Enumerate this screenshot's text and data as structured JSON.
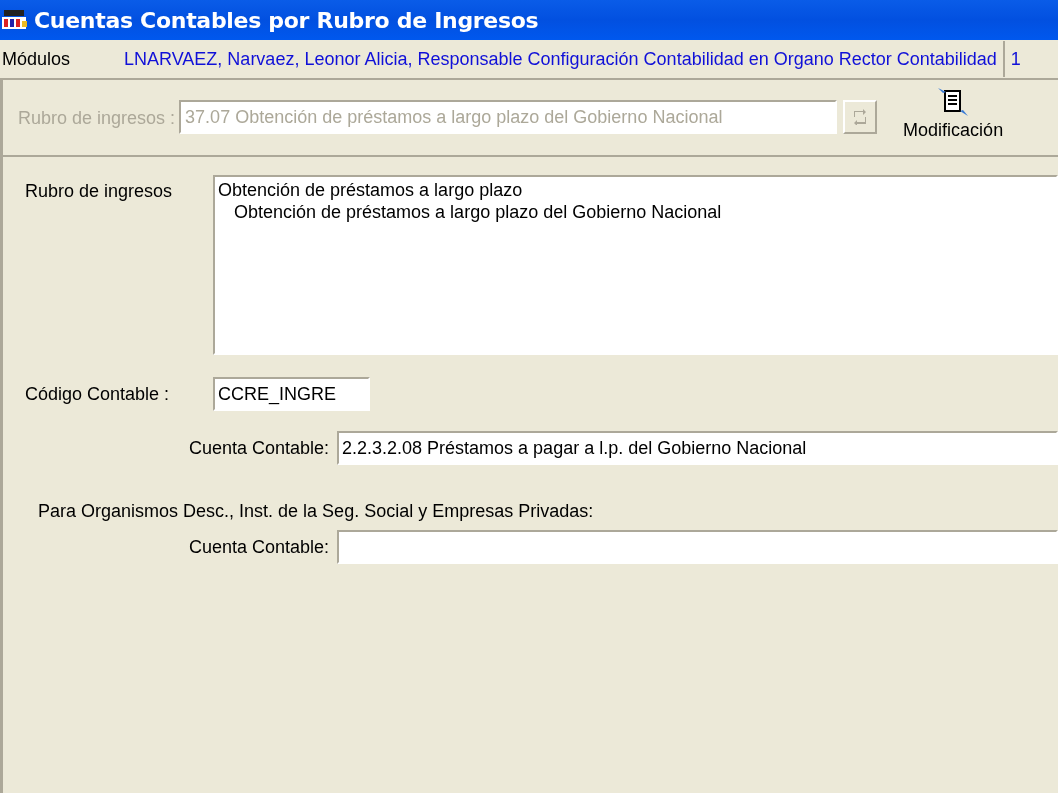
{
  "window": {
    "title": "Cuentas Contables por Rubro de Ingresos"
  },
  "menu_bar": {
    "menu": "Módulos",
    "user": "LNARVAEZ, Narvaez, Leonor Alicia, Responsable Configuración Contabilidad en Organo Rector Contabilidad",
    "extra": "1"
  },
  "toolbar": {
    "field": {
      "label": "Rubro de ingresos :",
      "value": "37.07 Obtención de préstamos a largo plazo del Gobierno Nacional",
      "disabled": true
    },
    "action": {
      "label": "Modificación"
    }
  },
  "form": {
    "rubro": {
      "label": "Rubro de ingresos",
      "items": [
        {
          "label": "Obtención de préstamos a largo plazo",
          "children": [
            {
              "label": "Obtención de préstamos a largo plazo del Gobierno Nacional"
            }
          ]
        }
      ]
    },
    "codigo": {
      "label": "Código Contable :",
      "value": "CCRE_INGRE"
    },
    "cuenta": {
      "label": "Cuenta Contable:",
      "value": "2.2.3.2.08 Préstamos a pagar a l.p. del Gobierno Nacional"
    },
    "section": "Para Organismos Desc., Inst. de la Seg. Social y Empresas Privadas:",
    "cuenta_2": {
      "label": "Cuenta Contable:"
    }
  }
}
